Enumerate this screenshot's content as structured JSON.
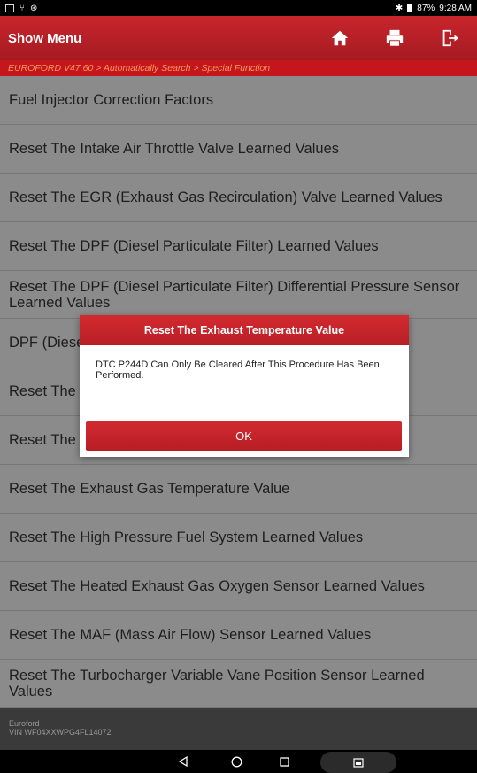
{
  "status": {
    "battery": "87%",
    "time": "9:28 AM"
  },
  "header": {
    "title": "Show Menu",
    "home_icon": "home-icon",
    "print_icon": "printer-icon",
    "exit_icon": "exit-icon"
  },
  "breadcrumb": "EUROFORD V47.60 > Automatically Search > Special Function",
  "menu": {
    "items": [
      "Fuel Injector Correction Factors",
      "Reset The Intake Air Throttle Valve Learned Values",
      "Reset The EGR (Exhaust Gas Recirculation) Valve Learned Values",
      "Reset The DPF (Diesel Particulate Filter) Learned Values",
      "Reset The DPF (Diesel Particulate Filter) Differential Pressure Sensor Learned Values",
      "DPF (Diesel",
      "Reset The",
      "Reset The",
      "Reset The Exhaust Gas Temperature Value",
      "Reset The High Pressure Fuel System Learned Values",
      "Reset The Heated Exhaust Gas Oxygen Sensor Learned Values",
      "Reset The MAF (Mass Air Flow) Sensor Learned Values",
      "Reset The Turbocharger Variable Vane Position Sensor Learned Values"
    ]
  },
  "footer": {
    "line1": "Euroford",
    "line2": "VIN WF04XXWPG4FL14072"
  },
  "dialog": {
    "title": "Reset The Exhaust Temperature Value",
    "message": "DTC P244D Can Only Be Cleared After This Procedure Has Been Performed.",
    "ok_label": "OK"
  },
  "colors": {
    "header_red": "#c9252c",
    "breadcrumb_text": "#f39a58",
    "list_bg": "#8b8b8b",
    "dialog_red": "#d32a31"
  }
}
